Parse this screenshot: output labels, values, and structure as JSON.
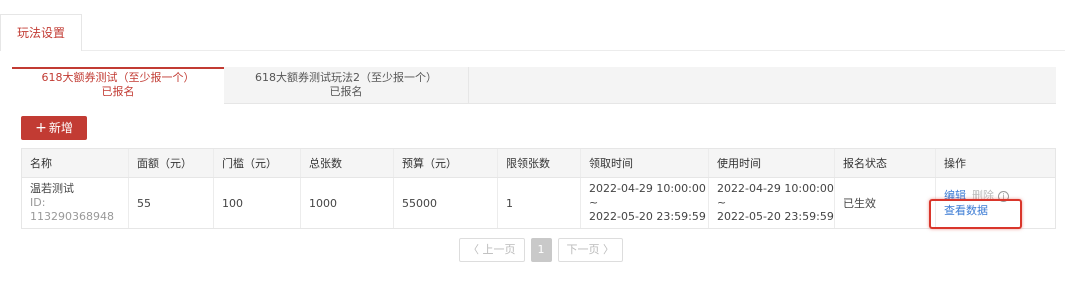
{
  "top_tab": {
    "label": "玩法设置"
  },
  "activity_tabs": [
    {
      "title": "618大额券测试（至少报一个）",
      "status": "已报名"
    },
    {
      "title": "618大额券测试玩法2（至少报一个）",
      "status": "已报名"
    }
  ],
  "add_button": {
    "label": "新增",
    "icon": "plus-icon"
  },
  "table": {
    "headers": [
      "名称",
      "面额（元）",
      "门槛（元）",
      "总张数",
      "预算（元）",
      "限领张数",
      "领取时间",
      "使用时间",
      "报名状态",
      "操作"
    ],
    "rows": [
      {
        "name": "温若测试",
        "id": "ID: 113290368948",
        "face_value": "55",
        "threshold": "100",
        "total": "1000",
        "budget": "55000",
        "limit": "1",
        "claim_time": "2022-04-29 10:00:00 ~\n2022-05-20 23:59:59",
        "claim_start": "2022-04-29 10:00:00 ~",
        "claim_end": "2022-05-20 23:59:59",
        "use_start": "2022-04-29 10:00:00 ~",
        "use_end": "2022-05-20 23:59:59",
        "status": "已生效",
        "actions": {
          "edit": "编辑",
          "delete": "删除",
          "view": "查看数据"
        }
      }
    ]
  },
  "pagination": {
    "prev": "〈 上一页",
    "current": "1",
    "next": "下一页 〉"
  },
  "colors": {
    "accent": "#c23b33",
    "link": "#3b7bd4",
    "highlight": "#d9362b"
  }
}
